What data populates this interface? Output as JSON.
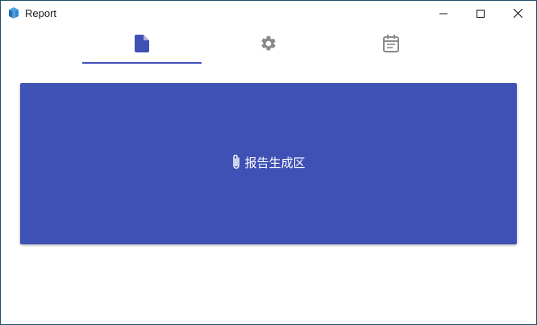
{
  "window": {
    "title": "Report",
    "icon": "app-cube-icon",
    "controls": [
      "minimize-icon",
      "maximize-icon",
      "close-icon"
    ]
  },
  "tabs": [
    {
      "icon": "document-icon",
      "active": true
    },
    {
      "icon": "gear-icon",
      "active": false
    },
    {
      "icon": "calendar-list-icon",
      "active": false
    }
  ],
  "panel": {
    "icon": "paperclip-icon",
    "label": "报告生成区"
  },
  "colors": {
    "accent": "#3f51b5",
    "icon_inactive": "#8a8a8a",
    "window_border": "#1f4e6b",
    "panel_text": "#ffffff"
  }
}
